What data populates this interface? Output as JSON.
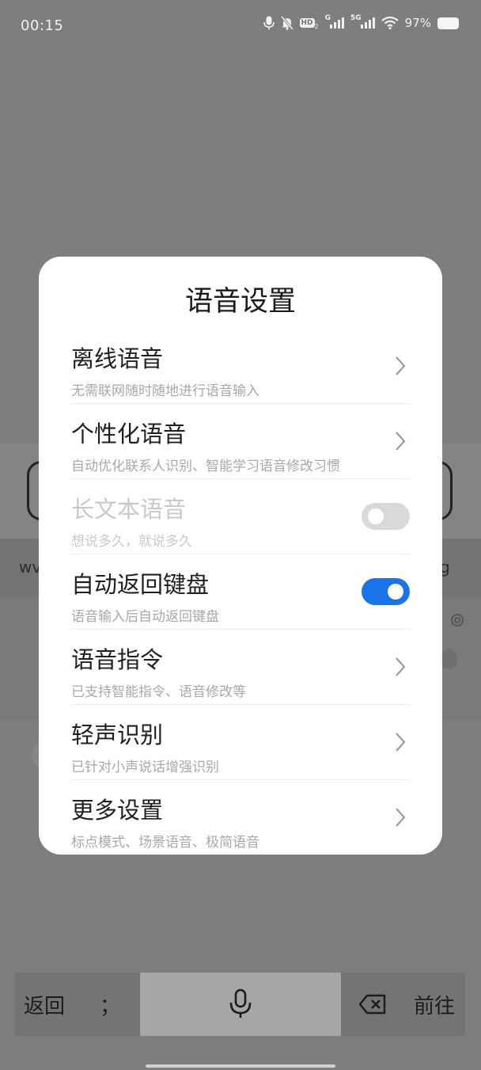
{
  "status_bar": {
    "time": "00:15",
    "hd_label": "HD",
    "hd_sub": "2",
    "net1_label": "G",
    "net2_label": "5G",
    "battery_level": "97%",
    "icons": [
      "microphone-icon",
      "bell-muted-icon",
      "hd-voice-icon",
      "signal-icon",
      "wifi-icon",
      "battery-icon"
    ]
  },
  "background": {
    "left_fragment": "wv",
    "right_fragment": "g"
  },
  "dialog": {
    "title": "语音设置",
    "rows": [
      {
        "label": "离线语音",
        "sub": "无需联网随时随地进行语音输入",
        "control": "chevron"
      },
      {
        "label": "个性化语音",
        "sub": "自动优化联系人识别、智能学习语音修改习惯",
        "control": "chevron"
      },
      {
        "label": "长文本语音",
        "sub": "想说多久，就说多久",
        "control": "toggle",
        "state": "off",
        "enabled": false
      },
      {
        "label": "自动返回键盘",
        "sub": "语音输入后自动返回键盘",
        "control": "toggle",
        "state": "on",
        "enabled": true
      },
      {
        "label": "语音指令",
        "sub": "已支持智能指令、语音修改等",
        "control": "chevron"
      },
      {
        "label": "轻声识别",
        "sub": "已针对小声说话增强识别",
        "control": "chevron"
      },
      {
        "label": "更多设置",
        "sub": "标点模式、场景语音、极简语音",
        "control": "chevron"
      }
    ]
  },
  "keyboard_bar": {
    "back_label": "返回",
    "punct_label": "；",
    "forward_label": "前往"
  },
  "colors": {
    "accent": "#1a73e8",
    "toggle_off": "#d9d9d9",
    "overlay": "#7e7e7e"
  }
}
